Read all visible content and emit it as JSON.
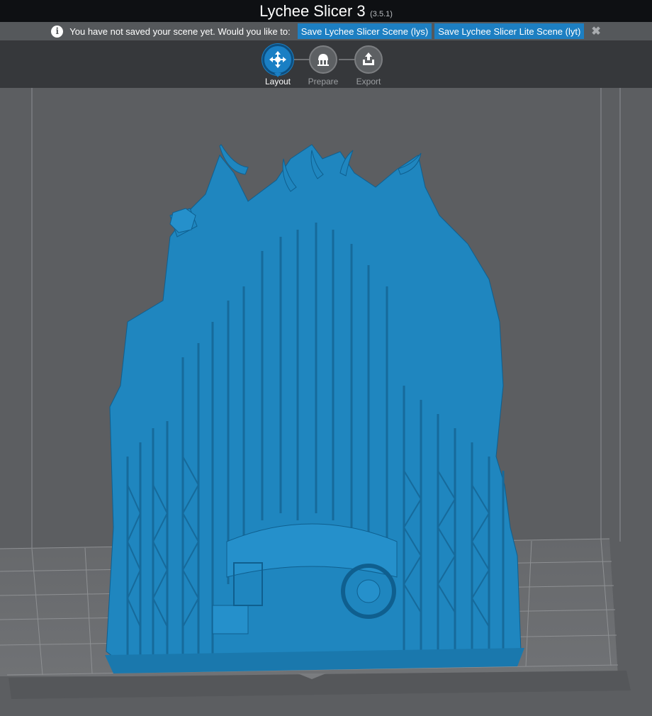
{
  "window": {
    "title": "Lychee Slicer 3",
    "version": "(3.5.1)"
  },
  "notification": {
    "icon": "info-icon",
    "message": "You have not saved your scene yet. Would you like to:",
    "save_lys_label": "Save Lychee Slicer Scene (lys)",
    "save_lyt_label": "Save Lychee Slicer Lite Scene (lyt)",
    "close_icon": "close-icon"
  },
  "workflow": {
    "active": "Layout",
    "steps": [
      {
        "label": "Layout",
        "icon": "move-arrows-icon"
      },
      {
        "label": "Prepare",
        "icon": "supports-icon"
      },
      {
        "label": "Export",
        "icon": "export-icon"
      }
    ]
  },
  "scene": {
    "model": "throne-miniature-with-supports",
    "model_color": "#1f86bf",
    "build_plate_color": "#6b6d70",
    "accent_color": "#1a7fc4"
  }
}
